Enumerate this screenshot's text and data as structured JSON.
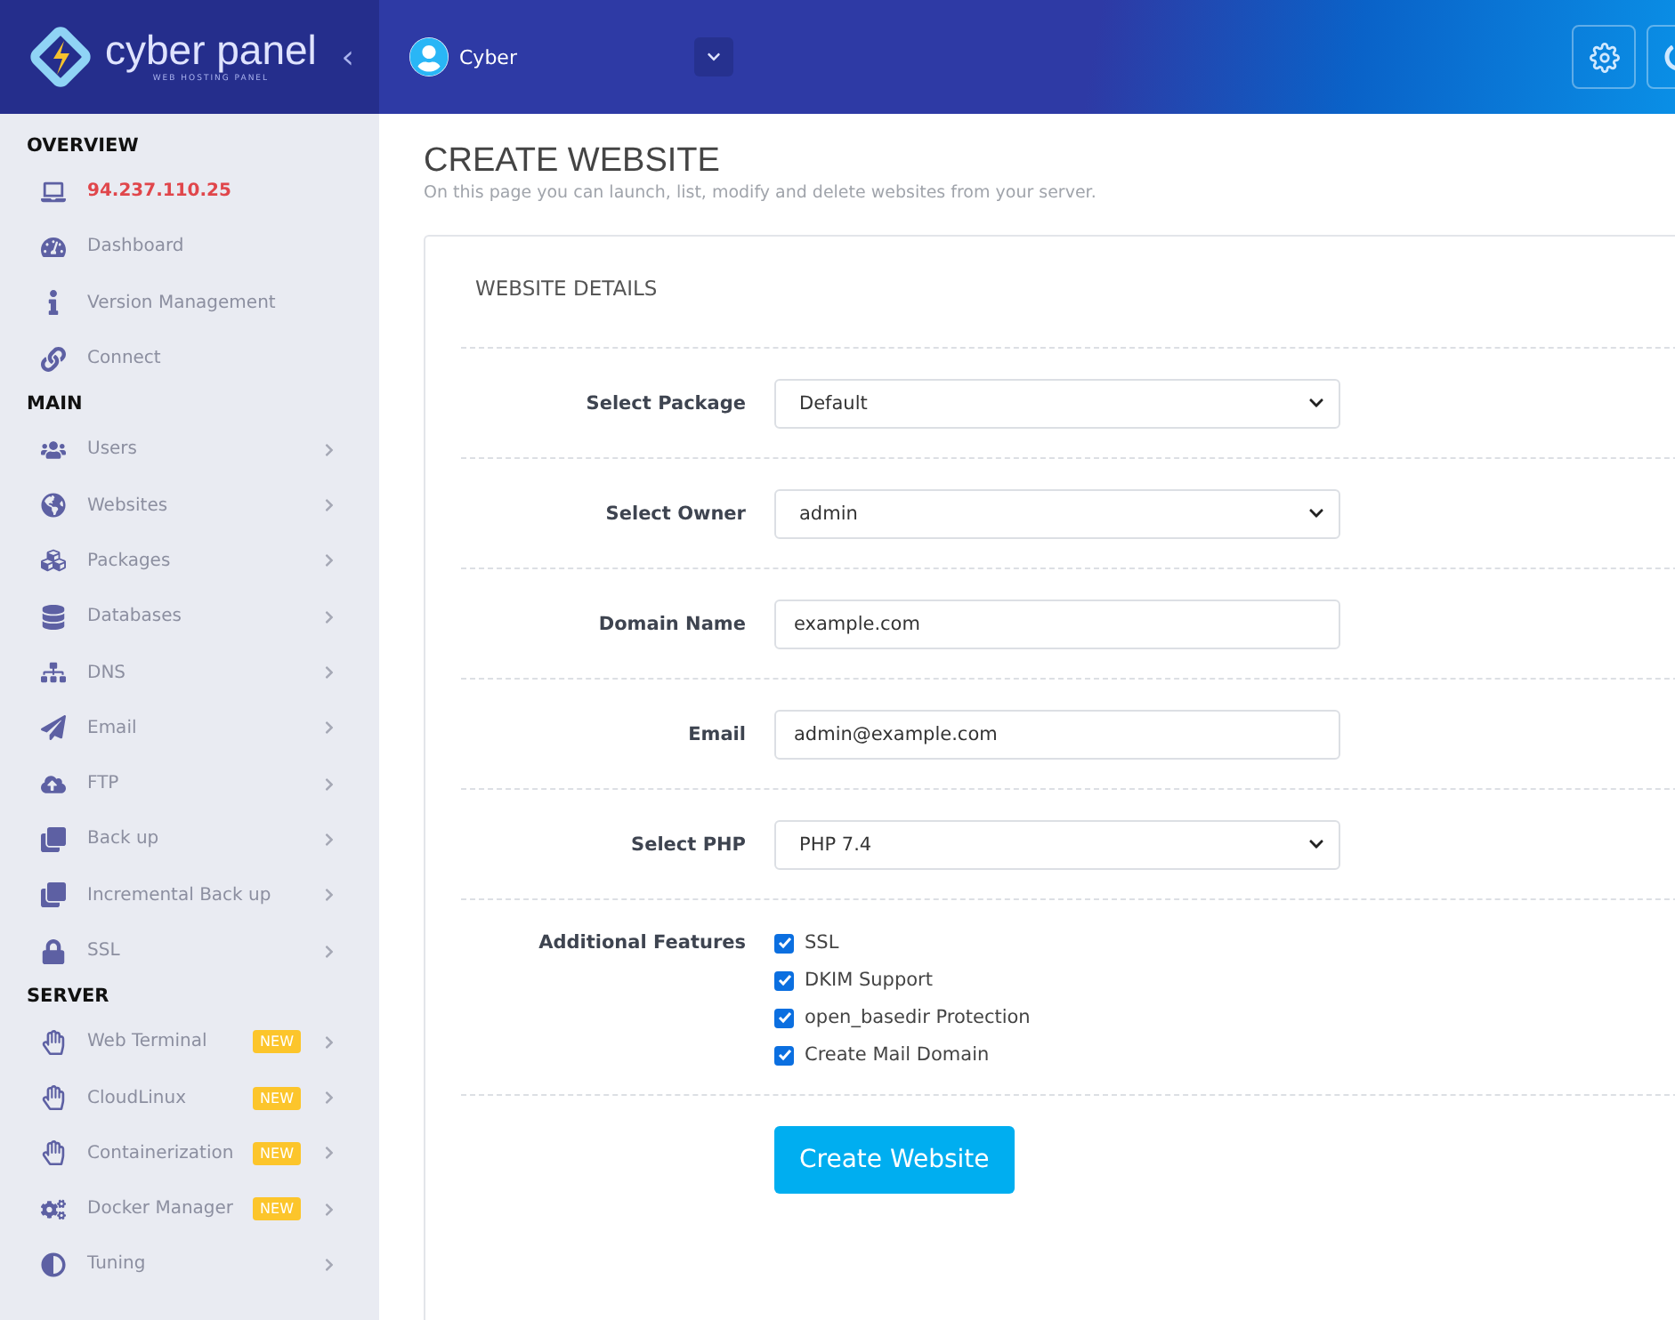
{
  "header": {
    "logo_text": "cyber panel",
    "logo_subtitle": "WEB HOSTING PANEL",
    "collapse_glyph": "‹",
    "user_name": "Cyber"
  },
  "sidebar": {
    "sections": [
      {
        "title": "OVERVIEW",
        "items": [
          {
            "label": "94.237.110.25",
            "kind": "ip",
            "has_arrow": false
          },
          {
            "label": "Dashboard",
            "kind": "link",
            "has_arrow": false
          },
          {
            "label": "Version Management",
            "kind": "link",
            "has_arrow": false
          },
          {
            "label": "Connect",
            "kind": "link",
            "has_arrow": false
          }
        ]
      },
      {
        "title": "MAIN",
        "items": [
          {
            "label": "Users",
            "kind": "link",
            "has_arrow": true
          },
          {
            "label": "Websites",
            "kind": "link",
            "has_arrow": true
          },
          {
            "label": "Packages",
            "kind": "link",
            "has_arrow": true
          },
          {
            "label": "Databases",
            "kind": "link",
            "has_arrow": true
          },
          {
            "label": "DNS",
            "kind": "link",
            "has_arrow": true
          },
          {
            "label": "Email",
            "kind": "link",
            "has_arrow": true
          },
          {
            "label": "FTP",
            "kind": "link",
            "has_arrow": true
          },
          {
            "label": "Back up",
            "kind": "link",
            "has_arrow": true
          },
          {
            "label": "Incremental Back up",
            "kind": "link",
            "has_arrow": true
          },
          {
            "label": "SSL",
            "kind": "link",
            "has_arrow": true
          }
        ]
      },
      {
        "title": "SERVER",
        "items": [
          {
            "label": "Web Terminal",
            "kind": "link",
            "has_arrow": true,
            "badge": "NEW"
          },
          {
            "label": "CloudLinux",
            "kind": "link",
            "has_arrow": true,
            "badge": "NEW"
          },
          {
            "label": "Containerization",
            "kind": "link",
            "has_arrow": true,
            "badge": "NEW"
          },
          {
            "label": "Docker Manager",
            "kind": "link",
            "has_arrow": true,
            "badge": "NEW"
          },
          {
            "label": "Tuning",
            "kind": "link",
            "has_arrow": true
          }
        ]
      }
    ]
  },
  "page": {
    "title": "CREATE WEBSITE",
    "subtitle": "On this page you can launch, list, modify and delete websites from your server.",
    "card_title": "WEBSITE DETAILS",
    "fields": [
      {
        "label": "Select Package",
        "kind": "select",
        "value": "Default"
      },
      {
        "label": "Select Owner",
        "kind": "select",
        "value": "admin"
      },
      {
        "label": "Domain Name",
        "kind": "input",
        "value": "example.com"
      },
      {
        "label": "Email",
        "kind": "input",
        "value": "admin@example.com"
      },
      {
        "label": "Select PHP",
        "kind": "select",
        "value": "PHP 7.4"
      }
    ],
    "features_label": "Additional Features",
    "features": [
      {
        "label": "SSL",
        "checked": true
      },
      {
        "label": "DKIM Support",
        "checked": true
      },
      {
        "label": "open_basedir Protection",
        "checked": true
      },
      {
        "label": "Create Mail Domain",
        "checked": true
      }
    ],
    "submit": "Create Website"
  }
}
